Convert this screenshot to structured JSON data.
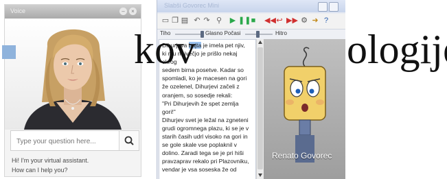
{
  "assistant": {
    "title": "Voice",
    "search_placeholder": "Type your question here...",
    "greeting_line1": "Hi! I'm your virtual assistant.",
    "greeting_line2": "How can I help you?"
  },
  "player": {
    "title": "Slabši Govorec Mini",
    "slider_left": "Tiho",
    "slider_mid": "Glasno Počasi",
    "slider_right": "Hitro",
    "text_lines": [
      "Dihurjeva bajta je imela pet njiv,",
      "ki mu največjo je prišlo nekaj okrog",
      "sedem birna posetve. Kadar so",
      "spomladi, ko je macesen na gori",
      "že ozelenel, Dihurjevi začeli z",
      "oranjem, so sosedje rekali:",
      "\"Pri Dihurjevih že spet zemlja",
      "gori!\"",
      "Dihurjev svet je ležal na zgneteni",
      "grudi ogromnega plazu, ki se je v",
      "starih časih udrl visoko na gori in",
      "se gole skale vse poplaknil v",
      "dolino. Zaradi tega se je pri hiši",
      "pravzaprav rekalo pri Plazovniku,",
      "vendar je vsa soseska že od"
    ],
    "highlight_word": "bajta",
    "agent_name": "Renato Govorec"
  },
  "heading": {
    "word1": "kov",
    "word2": "ologije"
  },
  "colors": {
    "bullet": "#8fb3dc",
    "highlight": "#9cc3f0",
    "agent_face": "#f1d06a"
  }
}
